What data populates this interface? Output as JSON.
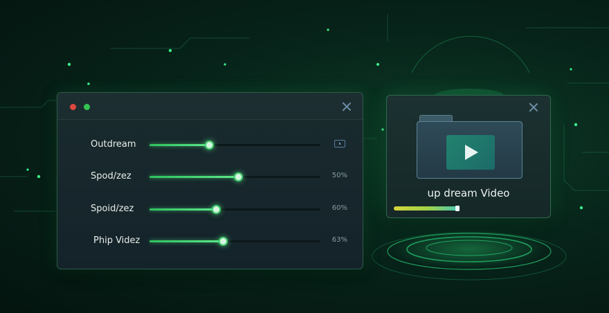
{
  "colors": {
    "accent": "#47d273",
    "window_dot_red": "#e0473e",
    "window_dot_green": "#34c452",
    "background": "#07241a"
  },
  "settings_window": {
    "rows": [
      {
        "label": "Outdream",
        "value": "",
        "level": 0.35,
        "value_icon": "stop-box-icon"
      },
      {
        "label": "Spod/zez",
        "value": "50%",
        "level": 0.52
      },
      {
        "label": "Spoid/zez",
        "value": "60%",
        "level": 0.39
      },
      {
        "label": "Phip Videz",
        "value": "63%",
        "level": 0.43
      }
    ]
  },
  "video_window": {
    "title": "up dream Video",
    "progress": 0.44,
    "icons": {
      "folder": "folder-icon",
      "play": "play-icon",
      "close": "close-icon"
    }
  }
}
